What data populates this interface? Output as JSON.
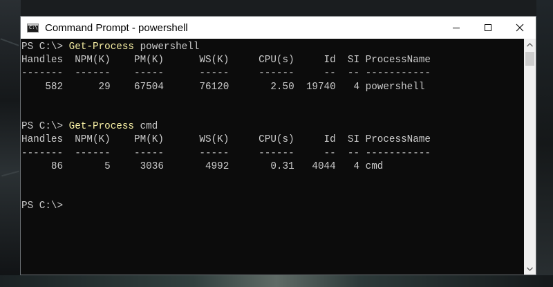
{
  "window": {
    "title": "Command Prompt - powershell"
  },
  "console": {
    "lines": [
      {
        "prompt": "PS C:\\> ",
        "command": "Get-Process",
        "args": " powershell"
      },
      {
        "text": "Handles  NPM(K)    PM(K)      WS(K)     CPU(s)     Id  SI ProcessName"
      },
      {
        "text": "-------  ------    -----      -----     ------     --  -- -----------"
      },
      {
        "text": "    582      29    67504      76120       2.50  19740   4 powershell"
      },
      {
        "text": ""
      },
      {
        "text": ""
      },
      {
        "prompt": "PS C:\\> ",
        "command": "Get-Process",
        "args": " cmd"
      },
      {
        "text": "Handles  NPM(K)    PM(K)      WS(K)     CPU(s)     Id  SI ProcessName"
      },
      {
        "text": "-------  ------    -----      -----     ------     --  -- -----------"
      },
      {
        "text": "     86       5     3036       4992       0.31   4044   4 cmd"
      },
      {
        "text": ""
      },
      {
        "text": ""
      },
      {
        "prompt": "PS C:\\>",
        "command": "",
        "args": ""
      }
    ]
  },
  "icons": {
    "app": "cmd-app-icon",
    "minimize": "minimize-icon",
    "maximize": "maximize-icon",
    "close": "close-icon",
    "scroll_up": "scroll-up-arrow-icon",
    "scroll_down": "scroll-down-arrow-icon"
  },
  "colors": {
    "console_bg": "#0c0c0c",
    "console_text": "#cccccc",
    "command_text": "#f9f1a5",
    "titlebar_bg": "#ffffff"
  }
}
